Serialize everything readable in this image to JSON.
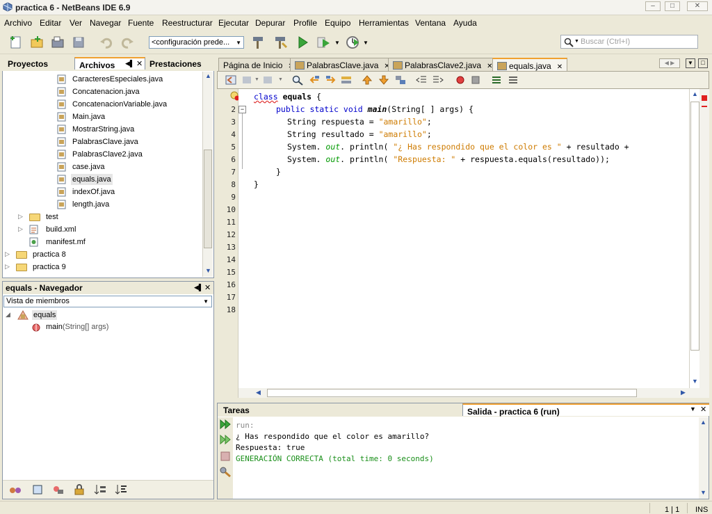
{
  "window": {
    "title": "practica 6 - NetBeans IDE 6.9"
  },
  "menu": [
    "Archivo",
    "Editar",
    "Ver",
    "Navegar",
    "Fuente",
    "Reestructurar",
    "Ejecutar",
    "Depurar",
    "Profile",
    "Equipo",
    "Herramientas",
    "Ventana",
    "Ayuda"
  ],
  "toolbar": {
    "config_value": "<configuración prede...",
    "search_placeholder": "Buscar (Ctrl+I)"
  },
  "left_tabs": {
    "proyectos": "Proyectos",
    "archivos": "Archivos",
    "prestaciones": "Prestaciones"
  },
  "files_tree": [
    "CaracteresEspeciales.java",
    "Concatenacion.java",
    "ConcatenacionVariable.java",
    "Main.java",
    "MostrarString.java",
    "PalabrasClave.java",
    "PalabrasClave2.java",
    "case.java",
    "equals.java",
    "indexOf.java",
    "length.java"
  ],
  "files_other": {
    "test": "test",
    "build": "build.xml",
    "manifest": "manifest.mf",
    "p8": "practica 8",
    "p9": "practica 9"
  },
  "navigator": {
    "title": "equals - Navegador",
    "view": "Vista de miembros",
    "class": "equals",
    "method": "main",
    "method_args": "(String[] args)"
  },
  "editor_tabs": [
    "Página de Inicio",
    "PalabrasClave.java",
    "PalabrasClave2.java",
    "equals.java"
  ],
  "line_numbers": [
    "1",
    "2",
    "3",
    "4",
    "5",
    "6",
    "7",
    "8",
    "9",
    "10",
    "11",
    "12",
    "13",
    "14",
    "15",
    "16",
    "17",
    "18"
  ],
  "code": {
    "l1_kw": "class",
    "l1_name": "equals",
    "l1_rest": " {",
    "l2_kw": "public static void",
    "l2_name": "main",
    "l2_rest": "(String[ ] args) {",
    "l3_a": "String respuesta = ",
    "l3_str": "\"amarillo\"",
    "l3_b": ";",
    "l4_a": "String resultado = ",
    "l4_str": "\"amarillo\"",
    "l4_b": ";",
    "l5_a": "System. ",
    "l5_out": "out",
    "l5_b": ". println( ",
    "l5_str": "\"¿ Has respondido que el color es \"",
    "l5_c": " + resultado +",
    "l6_a": "System. ",
    "l6_out": "out",
    "l6_b": ". println( ",
    "l6_str": "\"Respuesta: \"",
    "l6_c": " + respuesta.equals(resultado));",
    "l7": "}",
    "l8": "}"
  },
  "output": {
    "tasks_tab": "Tareas",
    "run_tab": "Salida - practica 6 (run)",
    "lines": [
      "run:",
      "¿ Has respondido que el color es amarillo?",
      "Respuesta: true",
      "GENERACIÓN CORRECTA (total time: 0 seconds)"
    ]
  },
  "status": {
    "position": "1 | 1",
    "mode": "INS"
  }
}
